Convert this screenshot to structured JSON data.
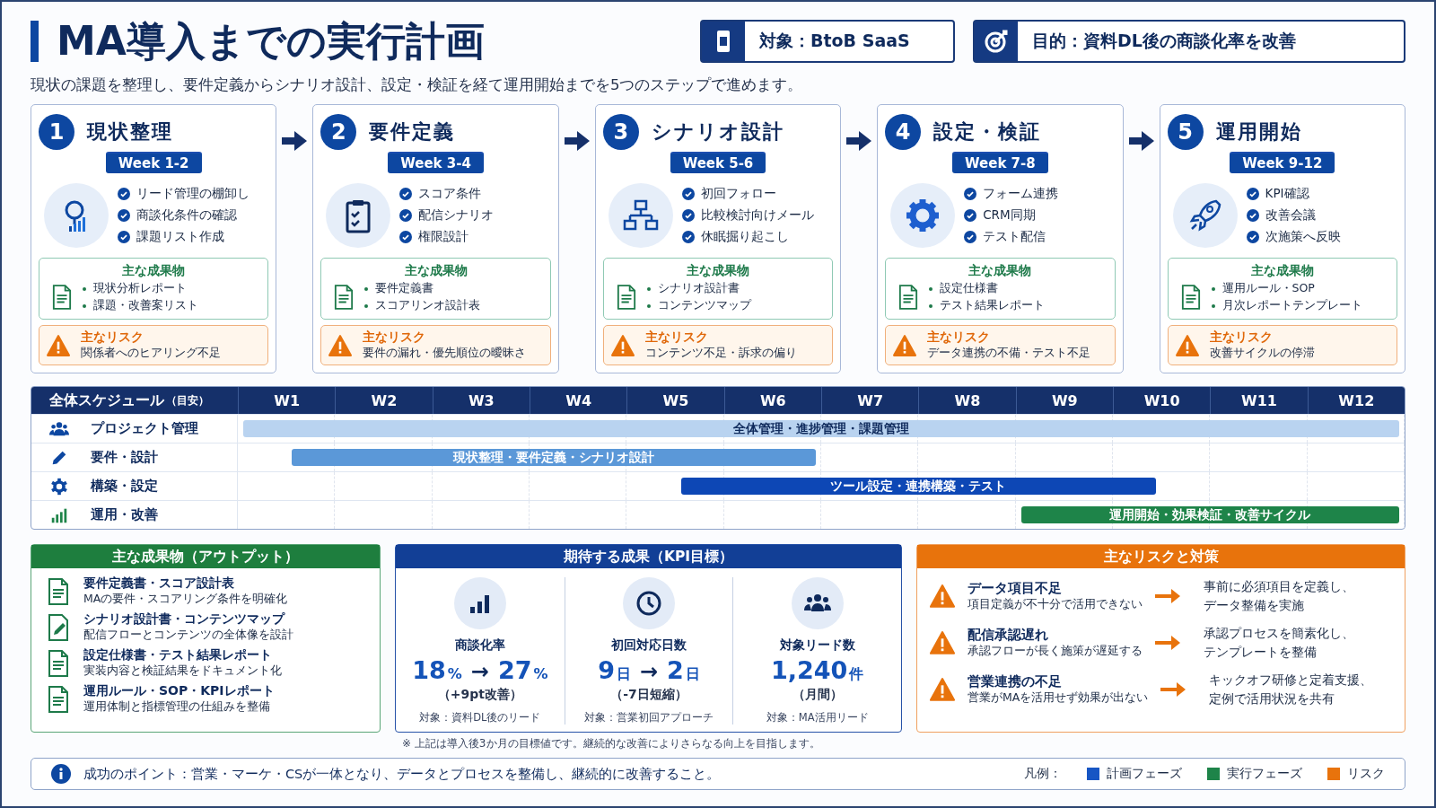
{
  "title": "MA導入までの実行計画",
  "tags": [
    {
      "label": "対象：BtoB SaaS"
    },
    {
      "label": "目的：資料DL後の商談化率を改善"
    }
  ],
  "subtitle": "現状の課題を整理し、要件定義からシナリオ設計、設定・検証を経て運用開始までを5つのステップで進めます。",
  "steps": [
    {
      "number": "1",
      "title": "現状整理",
      "week": "Week 1-2",
      "tasks": [
        "リード管理の棚卸し",
        "商談化条件の確認",
        "課題リスト作成"
      ],
      "deliverables_title": "主な成果物",
      "deliverables": [
        "現状分析レポート",
        "課題・改善案リスト"
      ],
      "risk_title": "主なリスク",
      "risk": "関係者へのヒアリング不足"
    },
    {
      "number": "2",
      "title": "要件定義",
      "week": "Week 3-4",
      "tasks": [
        "スコア条件",
        "配信シナリオ",
        "権限設計"
      ],
      "deliverables_title": "主な成果物",
      "deliverables": [
        "要件定義書",
        "スコアリンオ設計表"
      ],
      "risk_title": "主なリスク",
      "risk": "要件の漏れ・優先順位の曖昧さ"
    },
    {
      "number": "3",
      "title": "シナリオ設計",
      "week": "Week 5-6",
      "tasks": [
        "初回フォロー",
        "比較検討向けメール",
        "休眠掘り起こし"
      ],
      "deliverables_title": "主な成果物",
      "deliverables": [
        "シナリオ設計書",
        "コンテンツマップ"
      ],
      "risk_title": "主なリスク",
      "risk": "コンテンツ不足・訴求の偏り"
    },
    {
      "number": "4",
      "title": "設定・検証",
      "week": "Week 7-8",
      "tasks": [
        "フォーム連携",
        "CRM同期",
        "テスト配信"
      ],
      "deliverables_title": "主な成果物",
      "deliverables": [
        "設定仕様書",
        "テスト結果レポート"
      ],
      "risk_title": "主なリスク",
      "risk": "データ連携の不備・テスト不足"
    },
    {
      "number": "5",
      "title": "運用開始",
      "week": "Week 9-12",
      "tasks": [
        "KPI確認",
        "改善会議",
        "次施策へ反映"
      ],
      "deliverables_title": "主な成果物",
      "deliverables": [
        "運用ルール・SOP",
        "月次レポートテンプレート"
      ],
      "risk_title": "主なリスク",
      "risk": "改善サイクルの停滞"
    }
  ],
  "schedule": {
    "header": "全体スケジュール",
    "header_note": "（目安）",
    "weeks": [
      "W1",
      "W2",
      "W3",
      "W4",
      "W5",
      "W6",
      "W7",
      "W8",
      "W9",
      "W10",
      "W11",
      "W12"
    ],
    "rows": [
      {
        "label": "プロジェクト管理",
        "bar": {
          "label": "全体管理・進捗管理・課題管理",
          "color": "#b9d3f0"
        }
      },
      {
        "label": "要件・設計",
        "bar": {
          "label": "現状整理・要件定義・シナリオ設計",
          "color": "#5b98d8"
        }
      },
      {
        "label": "構築・設定",
        "bar": {
          "label": "ツール設定・連携構築・テスト",
          "color": "#0d47b5"
        }
      },
      {
        "label": "運用・改善",
        "bar": {
          "label": "運用開始・効果検証・改善サイクル",
          "color": "#1e8449"
        }
      }
    ]
  },
  "outputs": {
    "title": "主な成果物（アウトプット）",
    "items": [
      {
        "title": "要件定義書・スコア設計表",
        "desc": "MAの要件・スコアリング条件を明確化"
      },
      {
        "title": "シナリオ設計書・コンテンツマップ",
        "desc": "配信フローとコンテンツの全体像を設計"
      },
      {
        "title": "設定仕様書・テスト結果レポート",
        "desc": "実装内容と検証結果をドキュメント化"
      },
      {
        "title": "運用ルール・SOP・KPIレポート",
        "desc": "運用体制と指標管理の仕組みを整備"
      }
    ]
  },
  "kpi": {
    "title": "期待する成果（KPI目標）",
    "items": [
      {
        "label": "商談化率",
        "value": [
          {
            "kind": "num",
            "text": "18"
          },
          {
            "kind": "unit",
            "text": "%"
          },
          {
            "kind": "arrow",
            "text": "→"
          },
          {
            "kind": "num",
            "text": "27"
          },
          {
            "kind": "unit",
            "text": "%"
          }
        ],
        "change": "（+9pt改善）",
        "target": "対象：資料DL後のリード"
      },
      {
        "label": "初回対応日数",
        "value": [
          {
            "kind": "num",
            "text": "9"
          },
          {
            "kind": "unit",
            "text": "日"
          },
          {
            "kind": "arrow",
            "text": "→"
          },
          {
            "kind": "num",
            "text": "2"
          },
          {
            "kind": "unit",
            "text": "日"
          }
        ],
        "change": "（-7日短縮）",
        "target": "対象：営業初回アプローチ"
      },
      {
        "label": "対象リード数",
        "value": [
          {
            "kind": "num",
            "text": "1,240"
          },
          {
            "kind": "unit",
            "text": "件"
          }
        ],
        "change": "（月間）",
        "target": "対象：MA活用リード"
      }
    ],
    "note": "※ 上記は導入後3か月の目標値です。継続的な改善によりさらなる向上を目指します。"
  },
  "risks": {
    "title": "主なリスクと対策",
    "items": [
      {
        "title": "データ項目不足",
        "desc": "項目定義が不十分で活用できない",
        "action": [
          "事前に必須項目を定義し、",
          "データ整備を実施"
        ]
      },
      {
        "title": "配信承認遅れ",
        "desc": "承認フローが長く施策が遅延する",
        "action": [
          "承認プロセスを簡素化し、",
          "テンプレートを整備"
        ]
      },
      {
        "title": "営業連携の不足",
        "desc": "営業がMAを活用せず効果が出ない",
        "action": [
          "キックオフ研修と定着支援、",
          "定例で活用状況を共有"
        ]
      }
    ]
  },
  "footer": {
    "tip": "成功のポイント：営業・マーケ・CSが一体となり、データとプロセスを整備し、継続的に改善すること。",
    "legend_label": "凡例：",
    "legend": [
      {
        "label": "計画フェーズ",
        "color": "#1756c4"
      },
      {
        "label": "実行フェーズ",
        "color": "#1e8449"
      },
      {
        "label": "リスク",
        "color": "#e8730c"
      }
    ]
  }
}
